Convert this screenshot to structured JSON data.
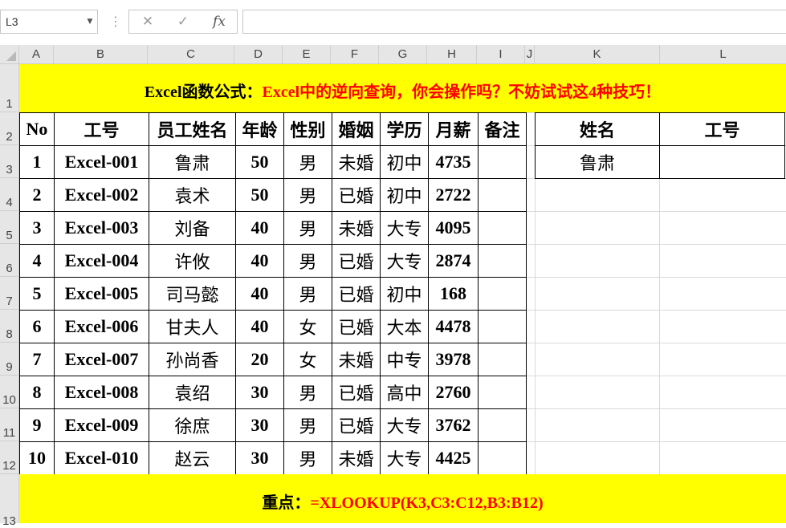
{
  "formula_bar": {
    "name_box": "L3",
    "cancel_icon": "✕",
    "enter_icon": "✓",
    "fx_label": "fx",
    "formula": ""
  },
  "columns": [
    "A",
    "B",
    "C",
    "D",
    "E",
    "F",
    "G",
    "H",
    "I",
    "J",
    "K",
    "L"
  ],
  "rows": [
    "1",
    "2",
    "3",
    "4",
    "5",
    "6",
    "7",
    "8",
    "9",
    "10",
    "11",
    "12",
    "13"
  ],
  "title": {
    "part1": "Excel函数公式：",
    "part2": "Excel中的逆向查询，你会操作吗？不妨试试这4种技巧！"
  },
  "table": {
    "headers": [
      "No",
      "工号",
      "员工姓名",
      "年龄",
      "性别",
      "婚姻",
      "学历",
      "月薪",
      "备注"
    ],
    "rows": [
      [
        "1",
        "Excel-001",
        "鲁肃",
        "50",
        "男",
        "未婚",
        "初中",
        "4735",
        ""
      ],
      [
        "2",
        "Excel-002",
        "袁术",
        "50",
        "男",
        "已婚",
        "初中",
        "2722",
        ""
      ],
      [
        "3",
        "Excel-003",
        "刘备",
        "40",
        "男",
        "未婚",
        "大专",
        "4095",
        ""
      ],
      [
        "4",
        "Excel-004",
        "许攸",
        "40",
        "男",
        "已婚",
        "大专",
        "2874",
        ""
      ],
      [
        "5",
        "Excel-005",
        "司马懿",
        "40",
        "男",
        "已婚",
        "初中",
        "168",
        ""
      ],
      [
        "6",
        "Excel-006",
        "甘夫人",
        "40",
        "女",
        "已婚",
        "大本",
        "4478",
        ""
      ],
      [
        "7",
        "Excel-007",
        "孙尚香",
        "20",
        "女",
        "未婚",
        "中专",
        "3978",
        ""
      ],
      [
        "8",
        "Excel-008",
        "袁绍",
        "30",
        "男",
        "已婚",
        "高中",
        "2760",
        ""
      ],
      [
        "9",
        "Excel-009",
        "徐庶",
        "30",
        "男",
        "已婚",
        "大专",
        "3762",
        ""
      ],
      [
        "10",
        "Excel-010",
        "赵云",
        "30",
        "男",
        "未婚",
        "大专",
        "4425",
        ""
      ]
    ]
  },
  "lookup": {
    "headers": [
      "姓名",
      "工号"
    ],
    "name_value": "鲁肃",
    "id_value": ""
  },
  "footer": {
    "label": "重点：",
    "formula": "=XLOOKUP(K3,C3:C12,B3:B12)"
  },
  "colors": {
    "highlight": "#ffff00",
    "accent_red": "#ff0000",
    "header_gray": "#e6e6e6"
  }
}
